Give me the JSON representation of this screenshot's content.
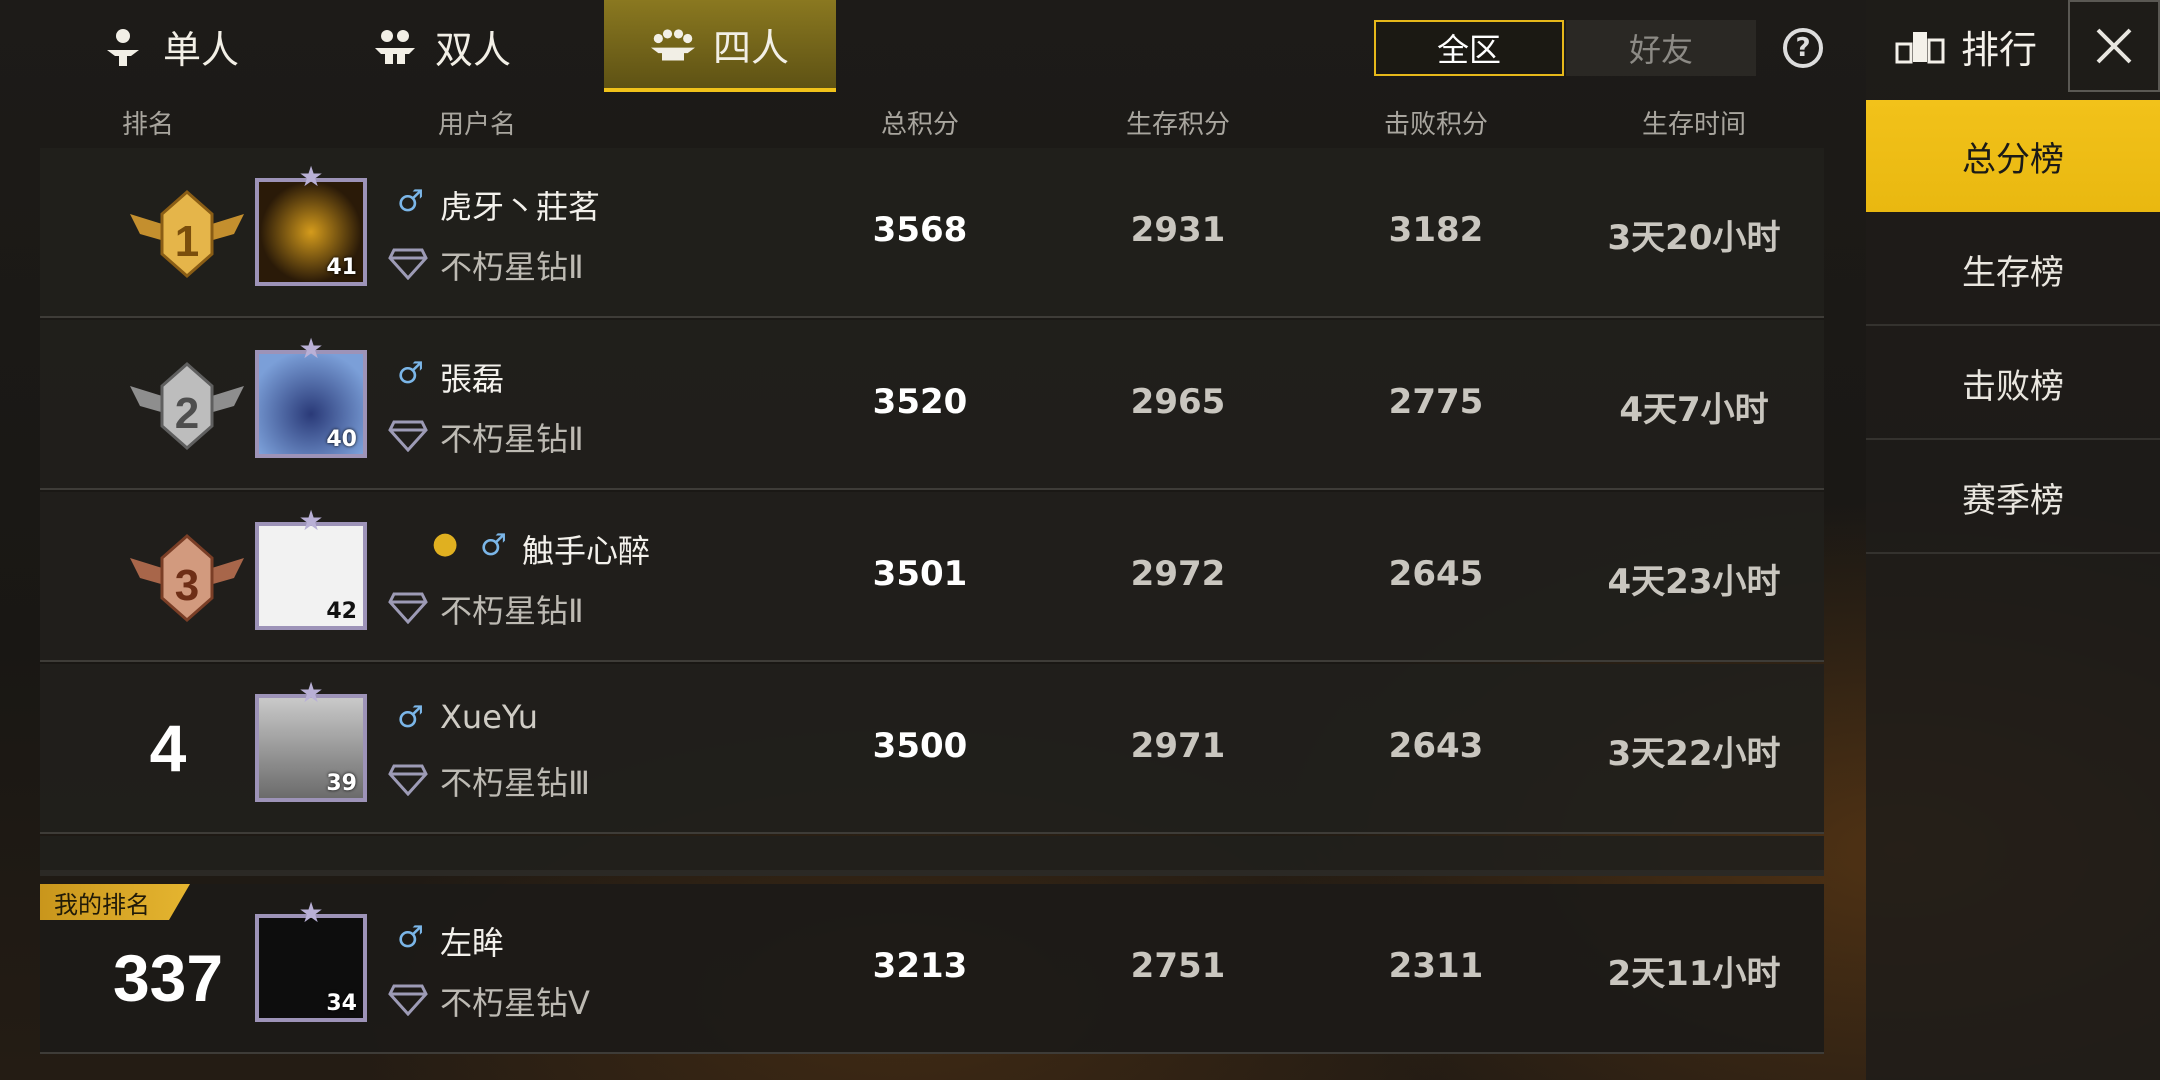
{
  "mode_tabs": [
    {
      "label": "单人",
      "icon": "single-person-icon",
      "active": false
    },
    {
      "label": "双人",
      "icon": "duo-people-icon",
      "active": false
    },
    {
      "label": "四人",
      "icon": "squad-people-icon",
      "active": true
    }
  ],
  "scope": {
    "region": "全区",
    "friends": "好友"
  },
  "help_icon": "question-icon",
  "columns": {
    "rank": "排名",
    "username": "用户名",
    "total": "总积分",
    "survival": "生存积分",
    "kill": "击败积分",
    "time": "生存时间"
  },
  "rows": [
    {
      "rank": "1",
      "name": "虎牙丶莊茗",
      "level": "41",
      "tier": "不朽星钻Ⅱ",
      "total": "3568",
      "survival": "2931",
      "kill": "3182",
      "time": "3天20小时"
    },
    {
      "rank": "2",
      "name": "張磊",
      "level": "40",
      "tier": "不朽星钻Ⅱ",
      "total": "3520",
      "survival": "2965",
      "kill": "2775",
      "time": "4天7小时"
    },
    {
      "rank": "3",
      "name": "触手心醉",
      "level": "42",
      "tier": "不朽星钻Ⅱ",
      "total": "3501",
      "survival": "2972",
      "kill": "2645",
      "time": "4天23小时"
    },
    {
      "rank": "4",
      "name": "XueYu",
      "level": "39",
      "tier": "不朽星钻Ⅲ",
      "total": "3500",
      "survival": "2971",
      "kill": "2643",
      "time": "3天22小时"
    }
  ],
  "my_rank": {
    "tag": "我的排名",
    "rank": "337",
    "name": "左眸",
    "level": "34",
    "tier": "不朽星钻Ⅴ",
    "total": "3213",
    "survival": "2751",
    "kill": "2311",
    "time": "2天11小时"
  },
  "gender_symbol": "♂",
  "sidebar": {
    "title": "排行",
    "items": [
      "总分榜",
      "生存榜",
      "击败榜",
      "赛季榜"
    ]
  },
  "colors": {
    "accent": "#f0c21a",
    "gold_medal": "#d9a437",
    "silver_medal": "#b8b8b8",
    "bronze_medal": "#c98b6a",
    "male": "#7bb6e8"
  }
}
